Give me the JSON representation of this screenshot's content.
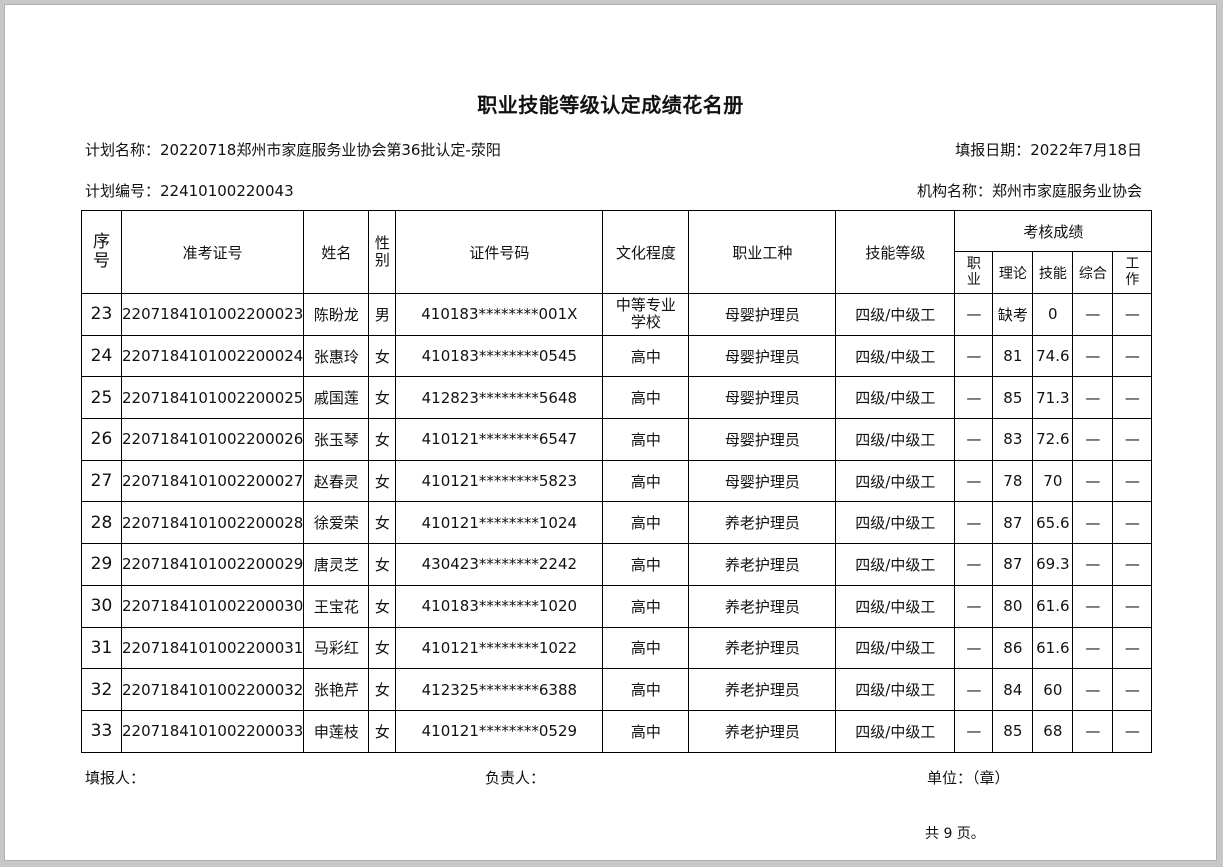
{
  "title": "职业技能等级认定成绩花名册",
  "meta": {
    "plan_name": "计划名称：20220718郑州市家庭服务业协会第36批认定-荥阳",
    "fill_date": "填报日期：2022年7月18日",
    "plan_no": "计划编号：22410100220043",
    "org_name": "机构名称：郑州市家庭服务业协会"
  },
  "table": {
    "headers": {
      "seq": "序号",
      "exam_no": "准考证号",
      "name": "姓名",
      "sex": "性别",
      "id_no": "证件号码",
      "education": "文化程度",
      "occupation": "职业工种",
      "level": "技能等级",
      "scores": "考核成绩",
      "sub": [
        "职业",
        "理论",
        "技能",
        "综合",
        "工作"
      ]
    },
    "rows": [
      {
        "seq": "23",
        "exam_no": "2207184101002200023",
        "name": "陈盼龙",
        "sex": "男",
        "id_no": "410183********001X",
        "education": "中等专业学校",
        "occupation": "母婴护理员",
        "level": "四级/中级工",
        "s1": "—",
        "s2": "缺考",
        "s3": "0",
        "s4": "—",
        "s5": "—"
      },
      {
        "seq": "24",
        "exam_no": "2207184101002200024",
        "name": "张惠玲",
        "sex": "女",
        "id_no": "410183********0545",
        "education": "高中",
        "occupation": "母婴护理员",
        "level": "四级/中级工",
        "s1": "—",
        "s2": "81",
        "s3": "74.6",
        "s4": "—",
        "s5": "—"
      },
      {
        "seq": "25",
        "exam_no": "2207184101002200025",
        "name": "戚国莲",
        "sex": "女",
        "id_no": "412823********5648",
        "education": "高中",
        "occupation": "母婴护理员",
        "level": "四级/中级工",
        "s1": "—",
        "s2": "85",
        "s3": "71.3",
        "s4": "—",
        "s5": "—"
      },
      {
        "seq": "26",
        "exam_no": "2207184101002200026",
        "name": "张玉琴",
        "sex": "女",
        "id_no": "410121********6547",
        "education": "高中",
        "occupation": "母婴护理员",
        "level": "四级/中级工",
        "s1": "—",
        "s2": "83",
        "s3": "72.6",
        "s4": "—",
        "s5": "—"
      },
      {
        "seq": "27",
        "exam_no": "2207184101002200027",
        "name": "赵春灵",
        "sex": "女",
        "id_no": "410121********5823",
        "education": "高中",
        "occupation": "母婴护理员",
        "level": "四级/中级工",
        "s1": "—",
        "s2": "78",
        "s3": "70",
        "s4": "—",
        "s5": "—"
      },
      {
        "seq": "28",
        "exam_no": "2207184101002200028",
        "name": "徐爱荣",
        "sex": "女",
        "id_no": "410121********1024",
        "education": "高中",
        "occupation": "养老护理员",
        "level": "四级/中级工",
        "s1": "—",
        "s2": "87",
        "s3": "65.6",
        "s4": "—",
        "s5": "—"
      },
      {
        "seq": "29",
        "exam_no": "2207184101002200029",
        "name": "唐灵芝",
        "sex": "女",
        "id_no": "430423********2242",
        "education": "高中",
        "occupation": "养老护理员",
        "level": "四级/中级工",
        "s1": "—",
        "s2": "87",
        "s3": "69.3",
        "s4": "—",
        "s5": "—"
      },
      {
        "seq": "30",
        "exam_no": "2207184101002200030",
        "name": "王宝花",
        "sex": "女",
        "id_no": "410183********1020",
        "education": "高中",
        "occupation": "养老护理员",
        "level": "四级/中级工",
        "s1": "—",
        "s2": "80",
        "s3": "61.6",
        "s4": "—",
        "s5": "—"
      },
      {
        "seq": "31",
        "exam_no": "2207184101002200031",
        "name": "马彩红",
        "sex": "女",
        "id_no": "410121********1022",
        "education": "高中",
        "occupation": "养老护理员",
        "level": "四级/中级工",
        "s1": "—",
        "s2": "86",
        "s3": "61.6",
        "s4": "—",
        "s5": "—"
      },
      {
        "seq": "32",
        "exam_no": "2207184101002200032",
        "name": "张艳芹",
        "sex": "女",
        "id_no": "412325********6388",
        "education": "高中",
        "occupation": "养老护理员",
        "level": "四级/中级工",
        "s1": "—",
        "s2": "84",
        "s3": "60",
        "s4": "—",
        "s5": "—"
      },
      {
        "seq": "33",
        "exam_no": "2207184101002200033",
        "name": "申莲枝",
        "sex": "女",
        "id_no": "410121********0529",
        "education": "高中",
        "occupation": "养老护理员",
        "level": "四级/中级工",
        "s1": "—",
        "s2": "85",
        "s3": "68",
        "s4": "—",
        "s5": "—"
      }
    ]
  },
  "footer": {
    "filler": "填报人：",
    "leader": "负责人：",
    "unit": "单位：（章）",
    "pages": "共 9 页。"
  }
}
